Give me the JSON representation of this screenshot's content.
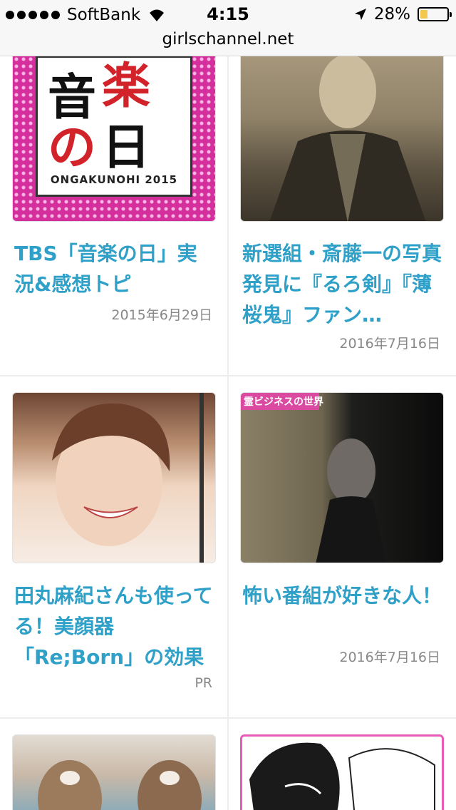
{
  "status_bar": {
    "carrier": "SoftBank",
    "time": "4:15",
    "battery_percent": "28%",
    "battery_level": 0.28,
    "battery_color": "#f2c94c"
  },
  "url_bar": {
    "domain": "girlschannel.net"
  },
  "thumb_music": {
    "chars": [
      "音",
      "楽",
      "の",
      "日"
    ],
    "caption": "ONGAKUNOHI 2015"
  },
  "thumb_ghost": {
    "caption": "霊ビジネスの世界"
  },
  "articles": [
    {
      "title": "TBS「音楽の日」実況&感想トピ",
      "date": "2015年6月29日",
      "thumb_icon": "music-day-logo"
    },
    {
      "title": "新選組・斎藤一の写真発見に『るろ剣』『薄桜鬼』ファン…",
      "date": "2016年7月16日",
      "thumb_icon": "old-portrait-photo"
    },
    {
      "title": "田丸麻紀さんも使ってる！美顔器「Re;Born」の効果っ…",
      "date": "PR",
      "thumb_icon": "smiling-woman-photo"
    },
    {
      "title": "怖い番組が好きな人！",
      "date": "2016年7月16日",
      "thumb_icon": "ghost-tv-screenshot"
    },
    {
      "title": "",
      "date": "",
      "thumb_icon": "cats-photo"
    },
    {
      "title": "",
      "date": "",
      "thumb_icon": "manga-illustration"
    }
  ],
  "colors": {
    "title": "#2fa0c8",
    "date": "#888888",
    "divider": "#eeeeee",
    "music_red": "#d2232a"
  }
}
